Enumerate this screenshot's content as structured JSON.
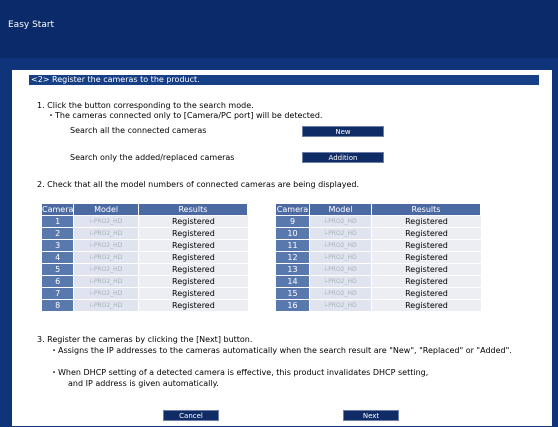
{
  "window": {
    "title": "Easy Start"
  },
  "step_header": "<2> Register the cameras to the product.",
  "step1": {
    "heading": "1. Click the button corresponding to the search mode.",
    "note": "・The cameras connected only to [Camera/PC port] will be detected.",
    "search_all_label": "Search all the connected cameras",
    "new_button": "New",
    "search_added_label": "Search only the  added/replaced cameras",
    "addition_button": "Addition"
  },
  "step2": {
    "heading": "2. Check that all the model numbers of connected cameras are being displayed.",
    "columns": [
      "Camera",
      "Model",
      "Results"
    ],
    "left_rows": [
      {
        "camera": "1",
        "model": "i-PRO2_HD",
        "result": "Registered"
      },
      {
        "camera": "2",
        "model": "i-PRO2_HD",
        "result": "Registered"
      },
      {
        "camera": "3",
        "model": "i-PRO2_HD",
        "result": "Registered"
      },
      {
        "camera": "4",
        "model": "i-PRO2_HD",
        "result": "Registered"
      },
      {
        "camera": "5",
        "model": "i-PRO2_HD",
        "result": "Registered"
      },
      {
        "camera": "6",
        "model": "i-PRO2_HD",
        "result": "Registered"
      },
      {
        "camera": "7",
        "model": "i-PRO2_HD",
        "result": "Registered"
      },
      {
        "camera": "8",
        "model": "i-PRO2_HD",
        "result": "Registered"
      }
    ],
    "right_rows": [
      {
        "camera": "9",
        "model": "i-PRO2_HD",
        "result": "Registered"
      },
      {
        "camera": "10",
        "model": "i-PRO2_HD",
        "result": "Registered"
      },
      {
        "camera": "11",
        "model": "i-PRO2_HD",
        "result": "Registered"
      },
      {
        "camera": "12",
        "model": "i-PRO2_HD",
        "result": "Registered"
      },
      {
        "camera": "13",
        "model": "i-PRO2_HD",
        "result": "Registered"
      },
      {
        "camera": "14",
        "model": "i-PRO2_HD",
        "result": "Registered"
      },
      {
        "camera": "15",
        "model": "i-PRO2_HD",
        "result": "Registered"
      },
      {
        "camera": "16",
        "model": "i-PRO2_HD",
        "result": "Registered"
      }
    ]
  },
  "step3": {
    "heading": "3. Register the cameras by clicking the [Next] button.",
    "note1": "・Assigns the IP addresses to the cameras automatically when the search result are \"New\", \"Replaced\" or \"Added\".",
    "note2_line1": "・When DHCP setting of a detected camera is effective, this product invalidates DHCP setting,",
    "note2_line2": "and IP address is given automatically."
  },
  "footer": {
    "cancel_button": "Cancel",
    "next_button": "Next"
  },
  "colors": {
    "background": "#10347a",
    "header_band": "#173f86",
    "table_header": "#4b6aa2",
    "button": "#0f2c66"
  }
}
